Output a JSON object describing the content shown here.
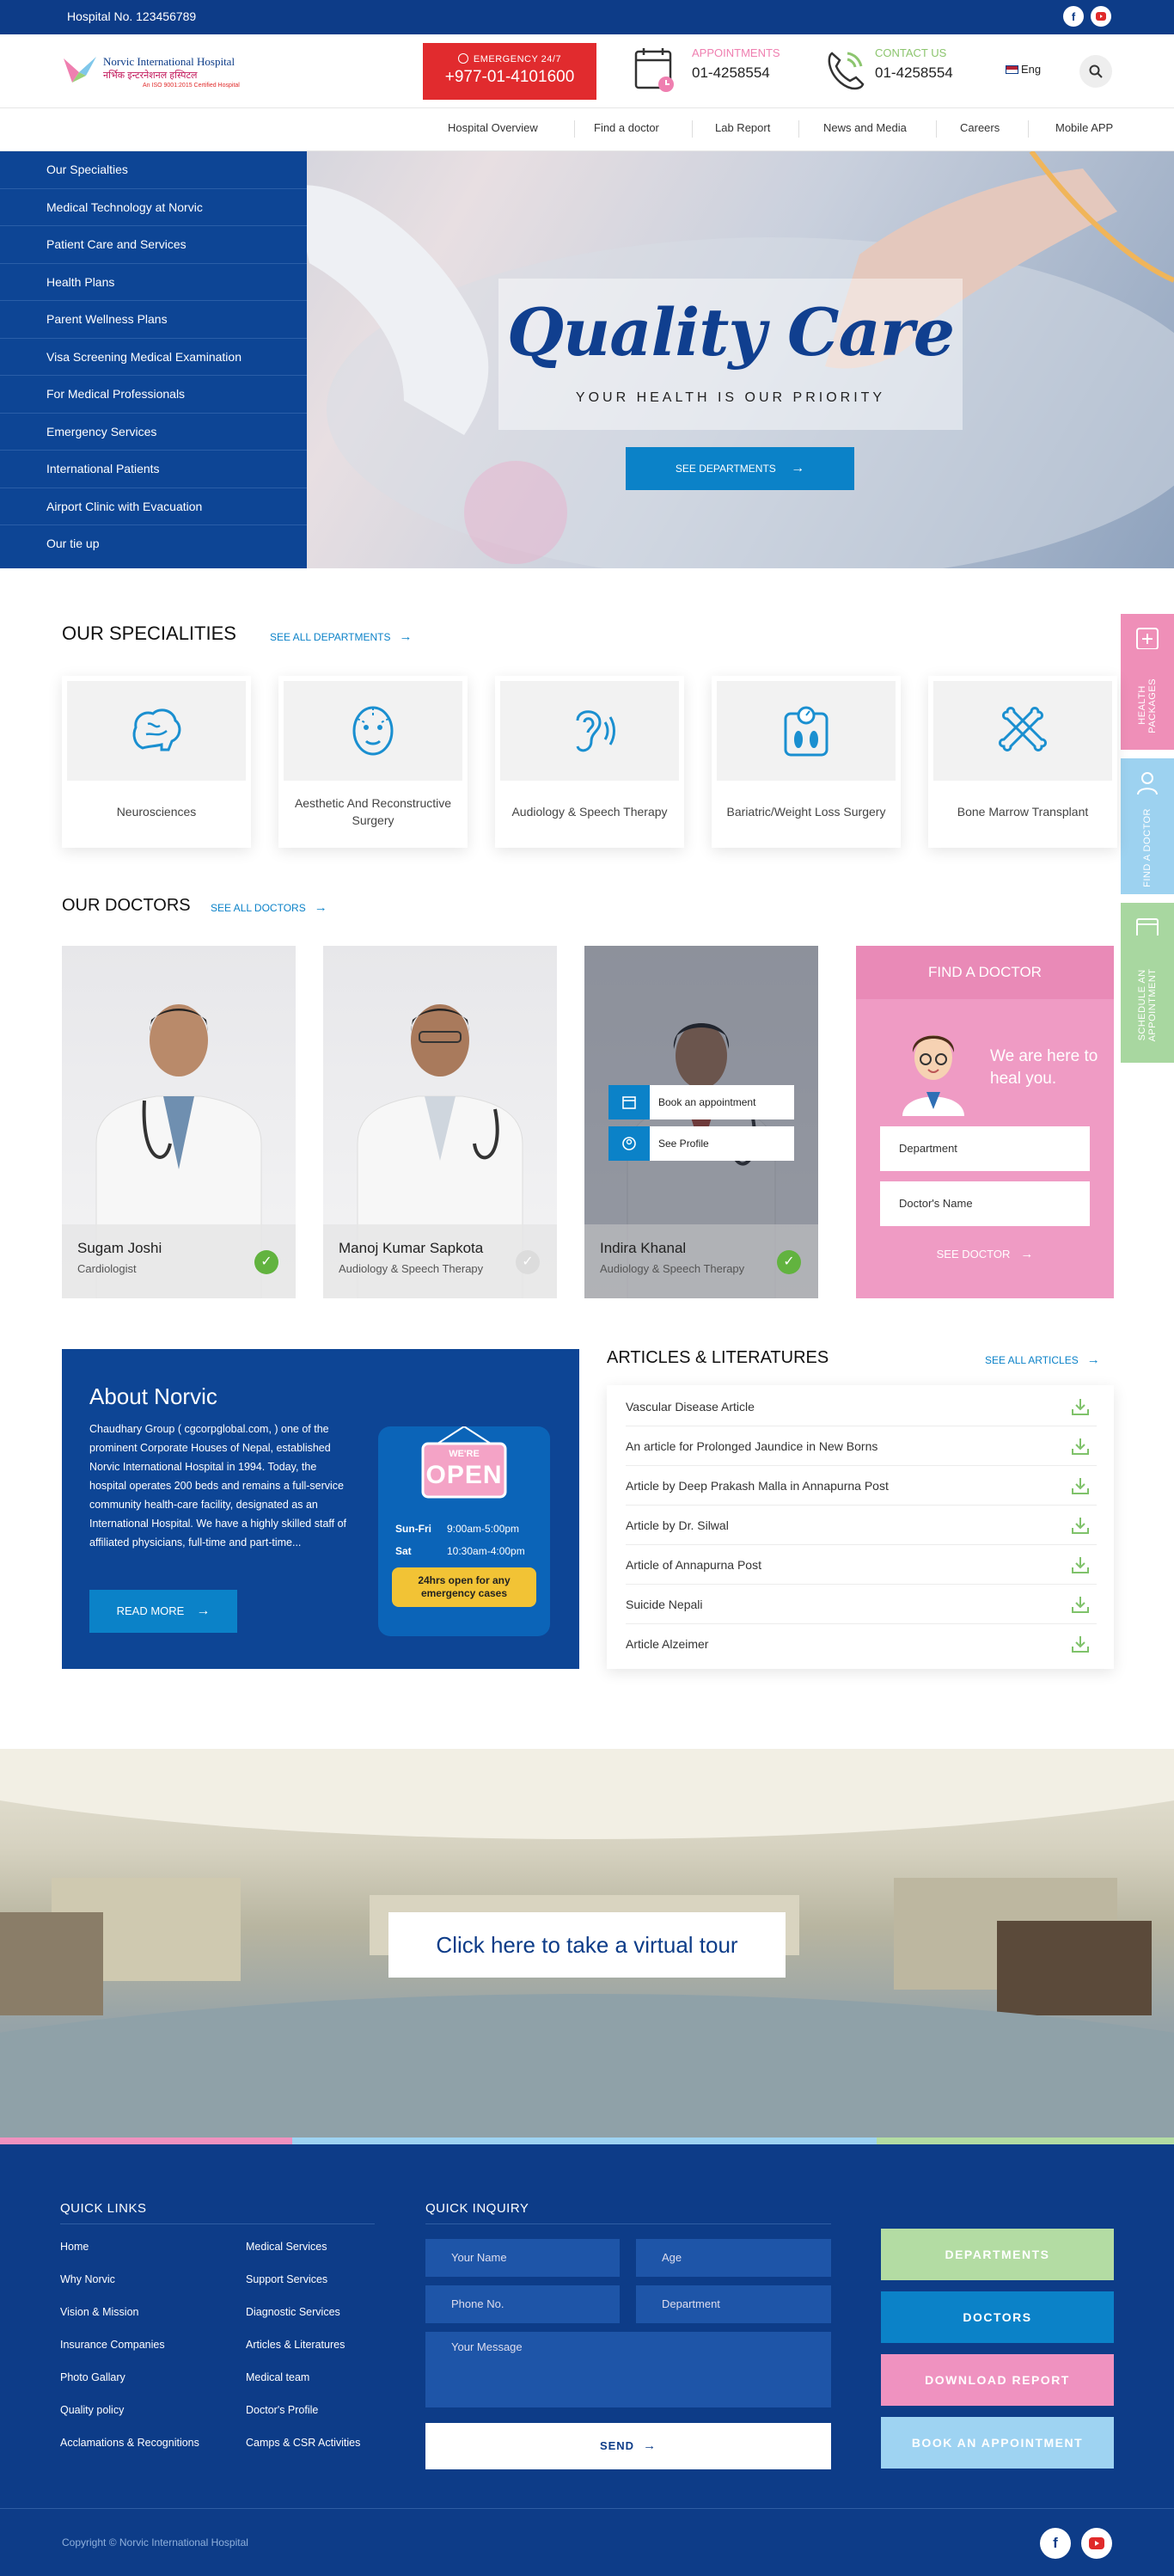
{
  "topbar": {
    "hospital_no": "Hospital No. 123456789",
    "social": [
      "facebook-icon",
      "youtube-icon"
    ]
  },
  "header": {
    "logo_title": "Norvic International Hospital",
    "logo_subtitle": "नर्भिक इन्टरनेशनल हस्पिटल",
    "logo_tag": "An ISO 9001:2015 Certified Hospital",
    "emergency_label": "EMERGENCY 24/7",
    "emergency_number": "+977-01-4101600",
    "appointments_label": "APPOINTMENTS",
    "appointments_number": "01-4258554",
    "contact_label": "CONTACT US",
    "contact_number": "01-4258554",
    "language": "Eng"
  },
  "nav": [
    "Hospital Overview",
    "Find a doctor",
    "Lab Report",
    "News and Media",
    "Careers",
    "Mobile APP"
  ],
  "sidemenu": [
    "Our Specialties",
    "Medical Technology at Norvic",
    "Patient Care and Services",
    "Health Plans",
    "Parent Wellness Plans",
    "Visa Screening Medical Examination",
    "For Medical Professionals",
    " Emergency Services",
    " International Patients",
    "Airport Clinic with Evacuation",
    "Our tie up"
  ],
  "hero": {
    "title": "Quality Care",
    "subtitle": "YOUR HEALTH IS OUR PRIORITY",
    "button": "SEE DEPARTMENTS"
  },
  "floating_tabs": [
    {
      "label": "HEALTH PACKAGES",
      "color": "#ef8fb8"
    },
    {
      "label": "FIND A DOCTOR",
      "color": "#9dd2f0"
    },
    {
      "label": "SCHEDULE AN APPOINTMENT",
      "color": "#a8d7a0"
    }
  ],
  "specialities": {
    "title": "OUR SPECIALITIES",
    "link": "SEE ALL DEPARTMENTS",
    "items": [
      "Neurosciences",
      "Aesthetic And Reconstructive Surgery",
      "Audiology & Speech Therapy",
      "Bariatric/Weight Loss Surgery",
      "Bone Marrow Transplant"
    ]
  },
  "doctors": {
    "title": "OUR DOCTORS",
    "link": "SEE ALL DOCTORS",
    "items": [
      {
        "name": "Sugam Joshi",
        "specialty": "Cardiologist"
      },
      {
        "name": "Manoj Kumar Sapkota",
        "specialty": "Audiology & Speech Therapy"
      },
      {
        "name": "Indira Khanal",
        "specialty": "Audiology & Speech Therapy"
      }
    ],
    "overlay_book": "Book an appointment",
    "overlay_profile": "See Profile"
  },
  "find_doctor": {
    "title": "FIND A DOCTOR",
    "tagline": "We are here to heal you.",
    "department": "Department",
    "doctor_name": "Doctor's Name",
    "button": "SEE DOCTOR"
  },
  "about": {
    "title": "About Norvic",
    "text": "Chaudhary Group ( cgcorpglobal.com, ) one of the prominent Corporate Houses of Nepal, established Norvic International Hospital in 1994. Today, the hospital operates 200 beds and remains a full-service community health-care facility, designated as an International Hospital. We have a highly skilled staff of affiliated physicians, full-time and part-time...",
    "button": "READ MORE",
    "sign_top": "WE'RE",
    "sign_main": "OPEN",
    "hours": [
      {
        "day": "Sun-Fri",
        "time": "9:00am-5:00pm"
      },
      {
        "day": "Sat",
        "time": "10:30am-4:00pm"
      }
    ],
    "note": "24hrs open for any emergency cases"
  },
  "articles": {
    "title": "ARTICLES & LITERATURES",
    "link": "SEE ALL ARTICLES",
    "items": [
      "Vascular Disease Article",
      "An article for Prolonged Jaundice in New Borns",
      "Article by Deep Prakash Malla in Annapurna Post",
      "Article by Dr. Silwal",
      "Article of Annapurna Post",
      "Suicide Nepali",
      "Article Alzeimer"
    ]
  },
  "tour": {
    "button": "Click here to take a virtual tour"
  },
  "footer": {
    "quick_links_title": "QUICK LINKS",
    "links_col1": [
      "Home",
      "Why Norvic",
      "Vision & Mission",
      "Insurance Companies",
      "Photo Gallary",
      "Quality policy",
      "Acclamations & Recognitions"
    ],
    "links_col2": [
      "Medical Services",
      "Support Services",
      "Diagnostic Services",
      "Articles & Literatures",
      "Medical team",
      "Doctor's Profile",
      "Camps & CSR Activities"
    ],
    "inquiry_title": "QUICK INQUIRY",
    "fields": {
      "name": "Your Name",
      "age": "Age",
      "phone": "Phone No.",
      "department": "Department",
      "message": "Your Message"
    },
    "send": "SEND",
    "buttons": [
      {
        "label": "DEPARTMENTS",
        "color": "#b3dca3"
      },
      {
        "label": "DOCTORS",
        "color": "#0b82c8"
      },
      {
        "label": "DOWNLOAD REPORT",
        "color": "#ef92c0"
      },
      {
        "label": "BOOK AN APPOINTMENT",
        "color": "#9ed3f2"
      }
    ],
    "copyright": "Copyright © Norvic International Hospital"
  }
}
